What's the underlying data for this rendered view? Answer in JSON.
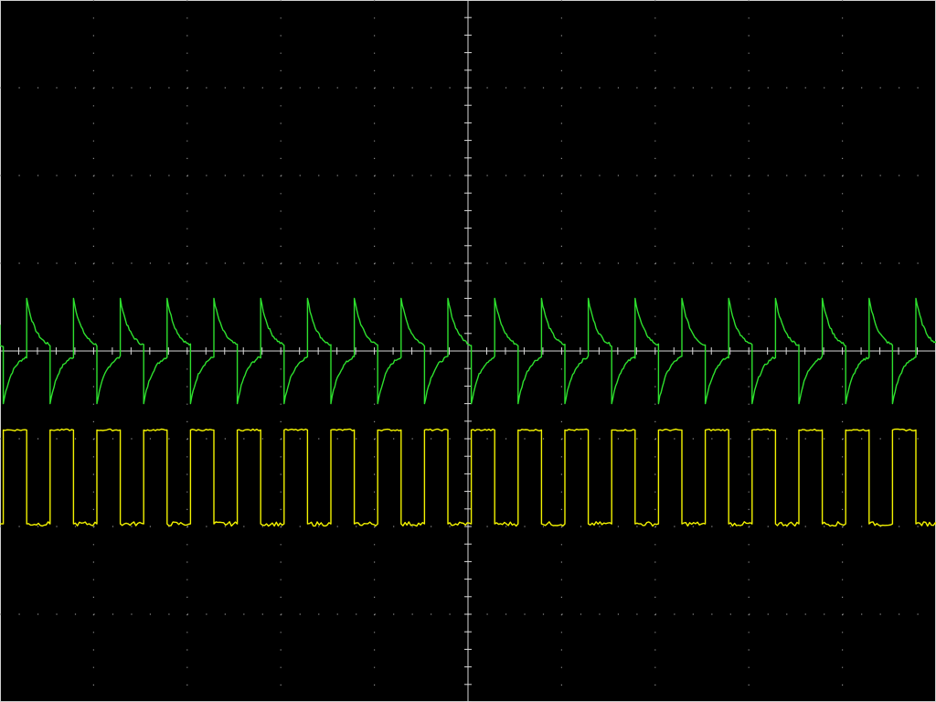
{
  "chart_data": {
    "type": "line",
    "title": "",
    "xlabel": "",
    "ylabel": "",
    "grid": true,
    "background": "#000000",
    "graticule": {
      "divisions_x": 10,
      "divisions_y": 8,
      "minor_ticks_per_division": 5
    },
    "xlim": [
      0,
      10
    ],
    "ylim": [
      -4,
      4
    ],
    "series": [
      {
        "color": "#2ee02e",
        "waveform": "exponential-decay-edges",
        "period_div": 0.5,
        "first_edge_div": 0.035,
        "peak_div": 0.6,
        "settle_div": 0.02,
        "trough_div": -0.6,
        "tau_div": 0.1
      },
      {
        "color": "#f2f200",
        "waveform": "square",
        "period_div": 0.5,
        "first_edge_div": 0.035,
        "duty": 0.5,
        "high_div": -0.9,
        "low_div": -1.97
      }
    ]
  }
}
